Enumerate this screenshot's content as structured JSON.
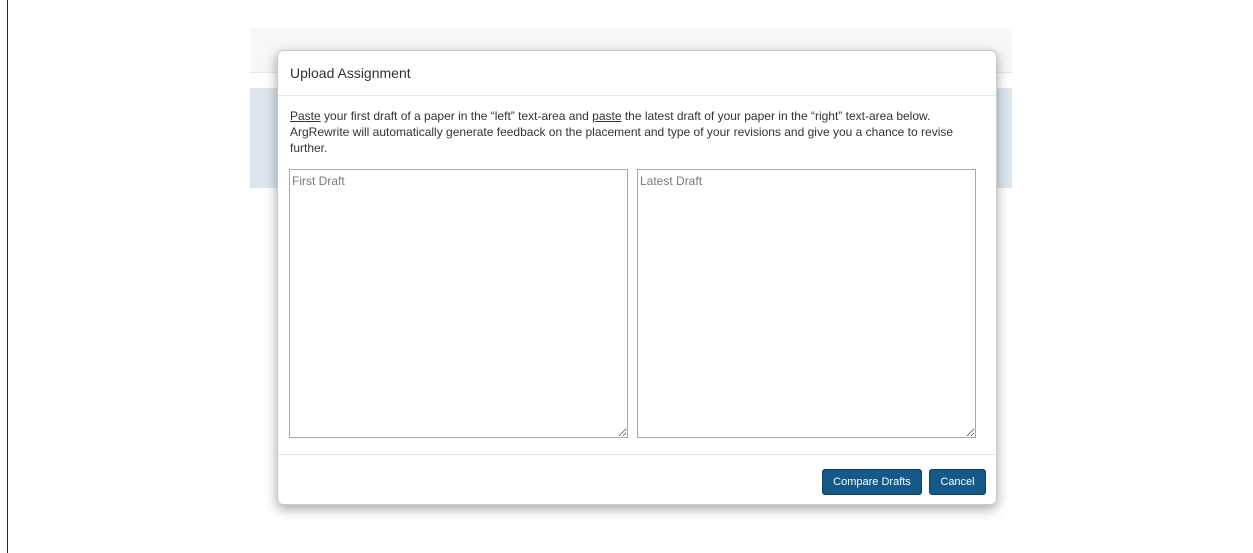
{
  "modal": {
    "title": "Upload Assignment",
    "instructions": {
      "part1": "Paste",
      "part2": " your first draft of a paper in the “left” text-area and ",
      "part3": "paste",
      "part4": " the latest draft of your paper in the “right” text-area below. ArgRewrite will automatically generate feedback on the placement and type of your revisions and give you a chance to revise further."
    },
    "first_draft": {
      "placeholder": "First Draft",
      "value": ""
    },
    "latest_draft": {
      "placeholder": "Latest Draft",
      "value": ""
    },
    "buttons": {
      "compare_label": "Compare Drafts",
      "cancel_label": "Cancel"
    }
  },
  "colors": {
    "primary_button": "#15598b",
    "banner_background": "#dde6ef"
  }
}
